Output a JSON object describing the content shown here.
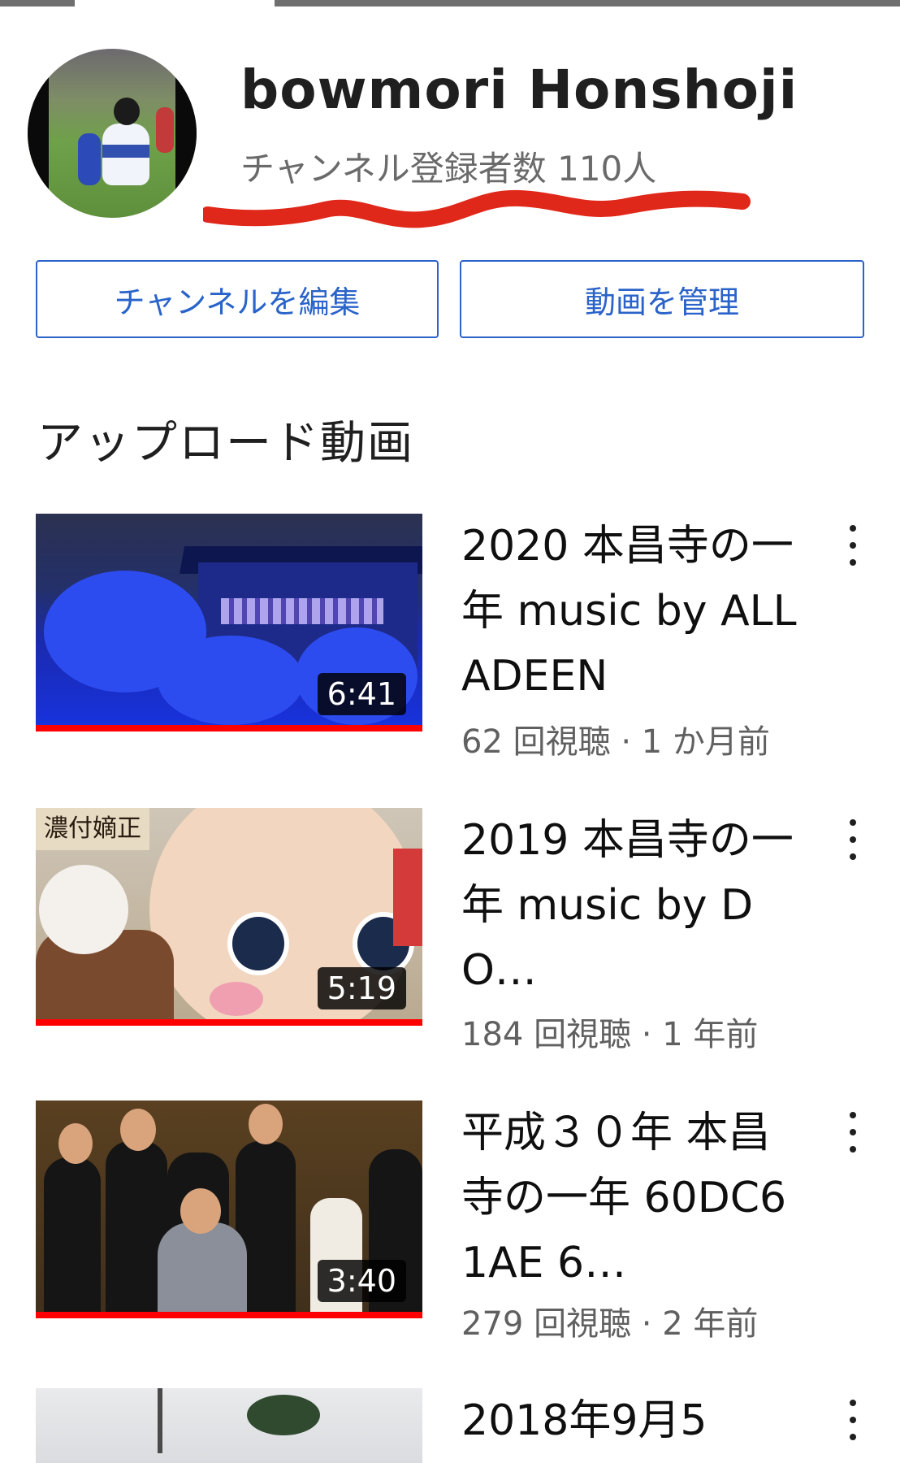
{
  "channel": {
    "name": "bowmori Honshoji",
    "subscribers": "チャンネル登録者数 110人"
  },
  "actions": {
    "edit_channel": "チャンネルを編集",
    "manage_videos": "動画を管理"
  },
  "section": {
    "title": "アップロード動画"
  },
  "videos": [
    {
      "title": "2020 本昌寺の一年 music by ALLADEEN",
      "meta": "62 回視聴 · 1 か月前",
      "duration": "6:41",
      "thumbnail": "blue-lit-temple-night"
    },
    {
      "title": "2019 本昌寺の一年 music by DO…",
      "meta": "184 回視聴 · 1 年前",
      "duration": "5:19",
      "thumbnail": "mascot-and-dog"
    },
    {
      "title": "平成３０年 本昌寺の一年 60DC61AE 6…",
      "meta": "279 回視聴 · 2 年前",
      "duration": "3:40",
      "thumbnail": "group-of-performers"
    },
    {
      "title": "2018年9月5",
      "meta": "",
      "duration": "",
      "thumbnail": "street-palm-trees"
    }
  ],
  "thumb_texts": {
    "sign": "濃付嫡正"
  },
  "icons": {
    "more": "more-vert-icon"
  },
  "colors": {
    "accent": "#2a63c9",
    "progress": "#ff0000",
    "annotation": "#e0281a"
  }
}
